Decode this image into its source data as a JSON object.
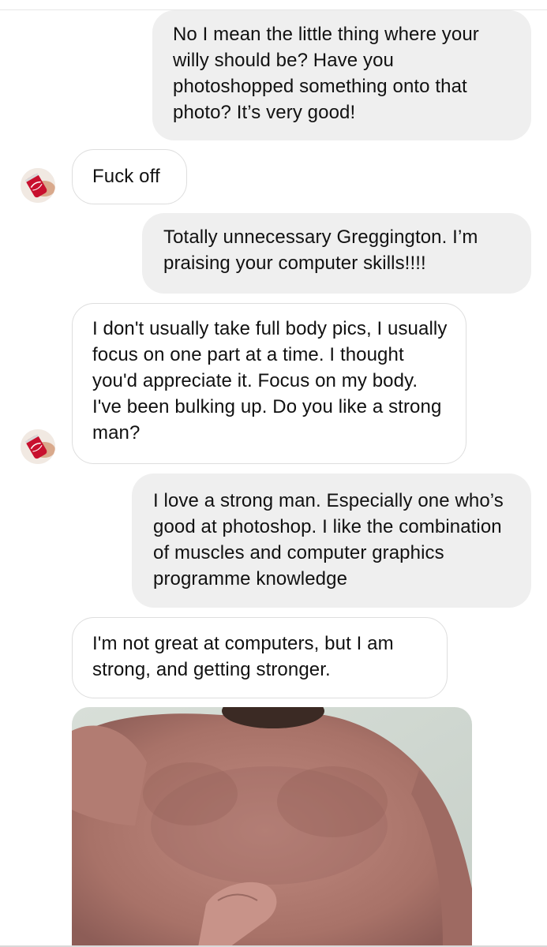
{
  "messages": [
    {
      "sender": "me",
      "text": "No I mean the little thing where your willy should be? Have you photoshopped something onto that photo? It’s very good!"
    },
    {
      "sender": "them",
      "text": "Fuck off"
    },
    {
      "sender": "me",
      "text": "Totally unnecessary Greggington. I’m praising your computer skills!!!!"
    },
    {
      "sender": "them",
      "text": "I don't usually take full body pics, I usually focus on one part at a time. I thought you'd appreciate it. Focus on my body. I've been bulking up. Do you like a strong man?"
    },
    {
      "sender": "me",
      "text": "I love a strong man. Especially one who’s good at photoshop. I like the combination of muscles and computer graphics programme knowledge"
    },
    {
      "sender": "them",
      "text": "I'm not great at computers, but I am strong, and getting stronger."
    }
  ],
  "avatar": {
    "icon": "soda-can-icon",
    "can_color": "#c8102e"
  },
  "colors": {
    "sent_bubble": "#efefef",
    "received_bubble_border": "#dedede",
    "text": "#111111"
  }
}
